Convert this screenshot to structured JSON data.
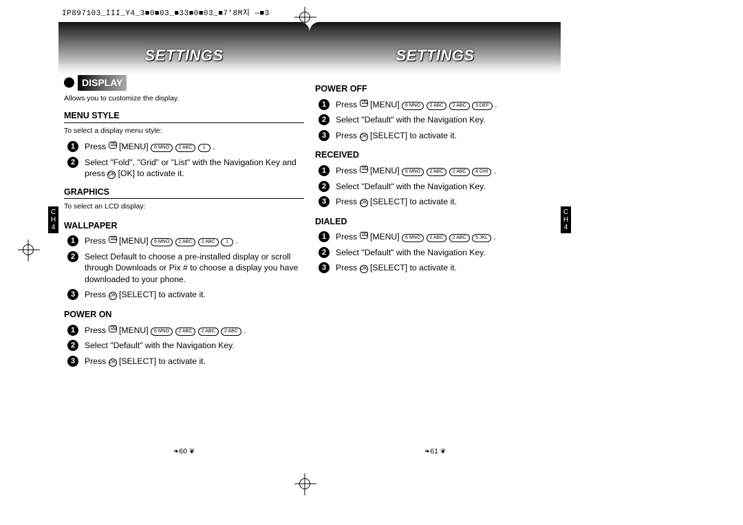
{
  "meta": {
    "doc_header": "IP897103_III_Y4_3■0■03_■33■0■03_■7'8M지 —■3"
  },
  "left": {
    "header": "SETTINGS",
    "section_badge": "DISPLAY",
    "section_desc": "Allows you to customize the display.",
    "menu_style": {
      "title": "MENU STYLE",
      "desc": "To select a display menu style:",
      "step1_a": "Press ",
      "step1_b": " [MENU] ",
      "step1_end": ".",
      "step2_a": "Select \"Fold\", \"Grid\" or \"List\" with the Navigation Key and press ",
      "step2_b": " [OK] to activate it."
    },
    "graphics": {
      "title": "GRAPHICS",
      "desc": "To select an LCD display:"
    },
    "wallpaper": {
      "title": "WALLPAPER",
      "step1_a": "Press ",
      "step1_b": " [MENU] ",
      "step1_end": ".",
      "step2": "Select Default to choose a pre-installed display or scroll through Downloads or Pix # to choose a display you have downloaded to your phone.",
      "step3_a": "Press ",
      "step3_b": " [SELECT] to activate it."
    },
    "power_on": {
      "title": "POWER ON",
      "step1_a": "Press ",
      "step1_b": " [MENU] ",
      "step1_end": ".",
      "step2": "Select \"Default\" with the Navigation Key.",
      "step3_a": "Press ",
      "step3_b": " [SELECT] to activate it."
    },
    "ch_tab": "C\nH\n4",
    "page_num": "60"
  },
  "right": {
    "header": "SETTINGS",
    "power_off": {
      "title": "POWER OFF",
      "step1_a": "Press ",
      "step1_b": " [MENU] ",
      "step1_end": ".",
      "step2": "Select \"Default\" with the Navigation Key.",
      "step3_a": "Press ",
      "step3_b": " [SELECT] to activate it."
    },
    "received": {
      "title": "RECEIVED",
      "step1_a": "Press ",
      "step1_b": " [MENU] ",
      "step1_end": ".",
      "step2": "Select \"Default\" with the Navigation Key.",
      "step3_a": "Press ",
      "step3_b": " [SELECT] to activate it."
    },
    "dialed": {
      "title": "DIALED",
      "step1_a": "Press ",
      "step1_b": " [MENU] ",
      "step1_end": ".",
      "step2": "Select \"Default\" with the Navigation Key.",
      "step3_a": "Press ",
      "step3_b": " [SELECT] to activate it."
    },
    "ch_tab": "C\nH\n4",
    "page_num": "61"
  },
  "keys": {
    "k6": "6 MNO",
    "k2": "2 ABC",
    "k3": "3 DEF",
    "k4": "4 GHI",
    "k5": "5 JKL",
    "k1": "1"
  }
}
